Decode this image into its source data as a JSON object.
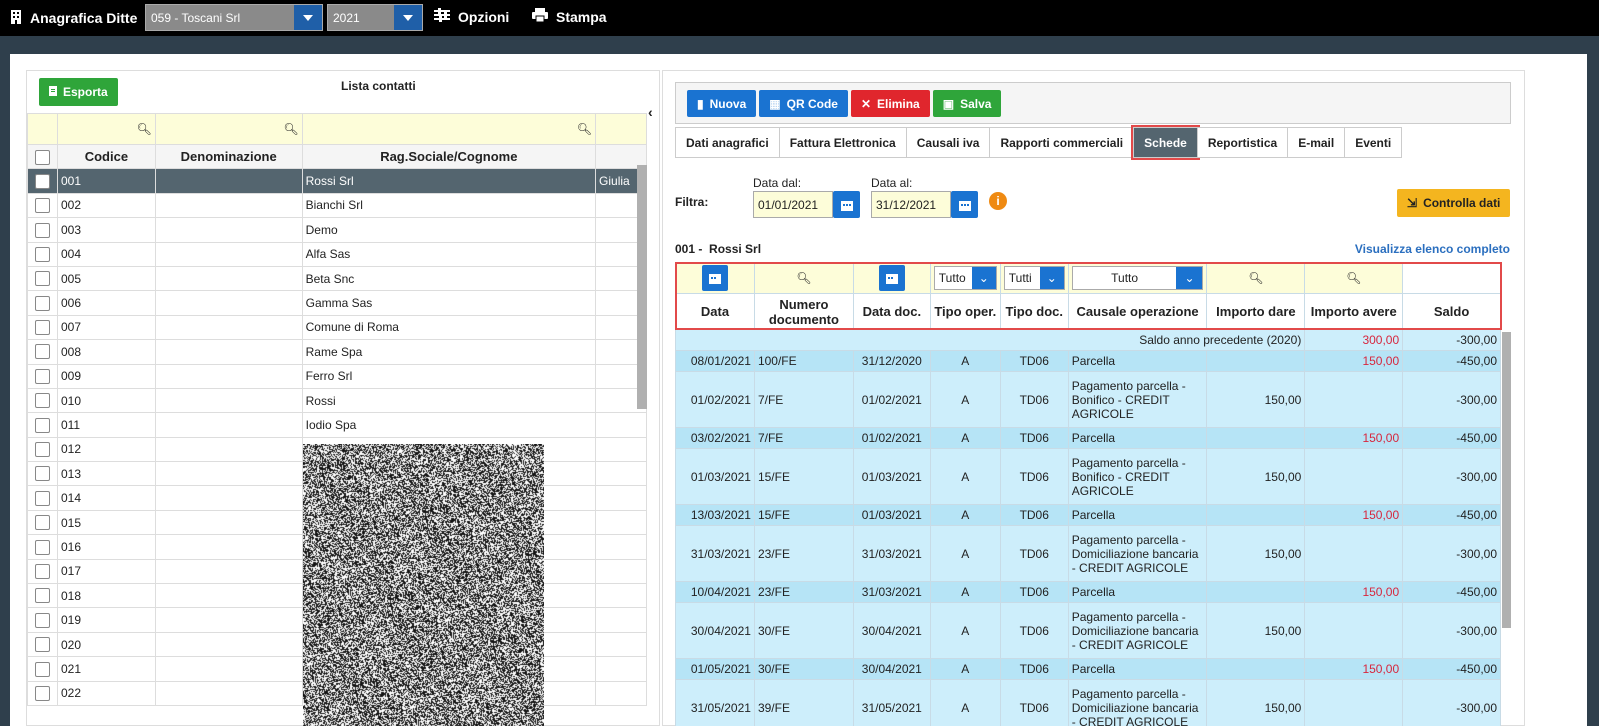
{
  "topbar": {
    "title": "Anagrafica Ditte",
    "company": "059 - Toscani Srl",
    "year": "2021",
    "options": "Opzioni",
    "print": "Stampa"
  },
  "left": {
    "export": "Esporta",
    "list_title": "Lista contatti",
    "columns": [
      "Codice",
      "Denominazione",
      "Rag.Sociale/Cognome"
    ],
    "rows": [
      {
        "code": "001",
        "name": "",
        "rag": "Rossi Srl",
        "extra": "Giulia"
      },
      {
        "code": "002",
        "name": "",
        "rag": "Bianchi Srl",
        "extra": ""
      },
      {
        "code": "003",
        "name": "",
        "rag": "Demo",
        "extra": ""
      },
      {
        "code": "004",
        "name": "",
        "rag": "Alfa Sas",
        "extra": ""
      },
      {
        "code": "005",
        "name": "",
        "rag": "Beta Snc",
        "extra": ""
      },
      {
        "code": "006",
        "name": "",
        "rag": "Gamma Sas",
        "extra": ""
      },
      {
        "code": "007",
        "name": "",
        "rag": "Comune di Roma",
        "extra": ""
      },
      {
        "code": "008",
        "name": "",
        "rag": "Rame Spa",
        "extra": ""
      },
      {
        "code": "009",
        "name": "",
        "rag": "Ferro Srl",
        "extra": ""
      },
      {
        "code": "010",
        "name": "",
        "rag": "Rossi",
        "extra": ""
      },
      {
        "code": "011",
        "name": "",
        "rag": "Iodio Spa",
        "extra": ""
      },
      {
        "code": "012",
        "name": "",
        "rag": "",
        "extra": ""
      },
      {
        "code": "013",
        "name": "",
        "rag": "",
        "extra": ""
      },
      {
        "code": "014",
        "name": "",
        "rag": "",
        "extra": ""
      },
      {
        "code": "015",
        "name": "",
        "rag": "",
        "extra": ""
      },
      {
        "code": "016",
        "name": "",
        "rag": "",
        "extra": ""
      },
      {
        "code": "017",
        "name": "",
        "rag": "",
        "extra": ""
      },
      {
        "code": "018",
        "name": "",
        "rag": "",
        "extra": ""
      },
      {
        "code": "019",
        "name": "",
        "rag": "",
        "extra": ""
      },
      {
        "code": "020",
        "name": "",
        "rag": "",
        "extra": ""
      },
      {
        "code": "021",
        "name": "",
        "rag": "",
        "extra": ""
      },
      {
        "code": "022",
        "name": "",
        "rag": "",
        "extra": ""
      }
    ]
  },
  "right": {
    "buttons": {
      "new": "Nuova",
      "qr": "QR Code",
      "delete": "Elimina",
      "save": "Salva"
    },
    "tabs": [
      "Dati anagrafici",
      "Fattura Elettronica",
      "Causali iva",
      "Rapporti commerciali",
      "Schede",
      "Reportistica",
      "E-mail",
      "Eventi"
    ],
    "active_tab": "Schede",
    "filter_label": "Filtra:",
    "date_from_label": "Data dal:",
    "date_from": "01/01/2021",
    "date_to_label": "Data al:",
    "date_to": "31/12/2021",
    "check_button": "Controlla dati",
    "entity_code": "001 -",
    "entity_name": "Rossi Srl",
    "full_list_link": "Visualizza elenco completo",
    "filters": {
      "tipo_oper": "Tutto",
      "tipo_doc": "Tutti",
      "causale": "Tutto"
    },
    "columns": [
      "Data",
      "Numero documento",
      "Data doc.",
      "Tipo oper.",
      "Tipo doc.",
      "Causale operazione",
      "Importo dare",
      "Importo avere",
      "Saldo"
    ],
    "opening": {
      "label": "Saldo anno precedente (2020)",
      "avere": "300,00",
      "saldo": "-300,00"
    },
    "rows": [
      {
        "data": "08/01/2021",
        "num": "100/FE",
        "datadoc": "31/12/2020",
        "oper": "A",
        "tdoc": "TD06",
        "causale": "Parcella",
        "dare": "",
        "avere": "150,00",
        "saldo": "-450,00"
      },
      {
        "data": "01/02/2021",
        "num": "7/FE",
        "datadoc": "01/02/2021",
        "oper": "A",
        "tdoc": "TD06",
        "causale": "Pagamento parcella - Bonifico - CREDIT AGRICOLE",
        "dare": "150,00",
        "avere": "",
        "saldo": "-300,00"
      },
      {
        "data": "03/02/2021",
        "num": "7/FE",
        "datadoc": "01/02/2021",
        "oper": "A",
        "tdoc": "TD06",
        "causale": "Parcella",
        "dare": "",
        "avere": "150,00",
        "saldo": "-450,00"
      },
      {
        "data": "01/03/2021",
        "num": "15/FE",
        "datadoc": "01/03/2021",
        "oper": "A",
        "tdoc": "TD06",
        "causale": "Pagamento parcella - Bonifico - CREDIT AGRICOLE",
        "dare": "150,00",
        "avere": "",
        "saldo": "-300,00"
      },
      {
        "data": "13/03/2021",
        "num": "15/FE",
        "datadoc": "01/03/2021",
        "oper": "A",
        "tdoc": "TD06",
        "causale": "Parcella",
        "dare": "",
        "avere": "150,00",
        "saldo": "-450,00"
      },
      {
        "data": "31/03/2021",
        "num": "23/FE",
        "datadoc": "31/03/2021",
        "oper": "A",
        "tdoc": "TD06",
        "causale": "Pagamento parcella - Domiciliazione bancaria - CREDIT AGRICOLE",
        "dare": "150,00",
        "avere": "",
        "saldo": "-300,00"
      },
      {
        "data": "10/04/2021",
        "num": "23/FE",
        "datadoc": "31/03/2021",
        "oper": "A",
        "tdoc": "TD06",
        "causale": "Parcella",
        "dare": "",
        "avere": "150,00",
        "saldo": "-450,00"
      },
      {
        "data": "30/04/2021",
        "num": "30/FE",
        "datadoc": "30/04/2021",
        "oper": "A",
        "tdoc": "TD06",
        "causale": "Pagamento parcella - Domiciliazione bancaria - CREDIT AGRICOLE",
        "dare": "150,00",
        "avere": "",
        "saldo": "-300,00"
      },
      {
        "data": "01/05/2021",
        "num": "30/FE",
        "datadoc": "30/04/2021",
        "oper": "A",
        "tdoc": "TD06",
        "causale": "Parcella",
        "dare": "",
        "avere": "150,00",
        "saldo": "-450,00"
      },
      {
        "data": "31/05/2021",
        "num": "39/FE",
        "datadoc": "31/05/2021",
        "oper": "A",
        "tdoc": "TD06",
        "causale": "Pagamento parcella - Domiciliazione bancaria - CREDIT AGRICOLE",
        "dare": "150,00",
        "avere": "",
        "saldo": "-300,00"
      }
    ]
  }
}
